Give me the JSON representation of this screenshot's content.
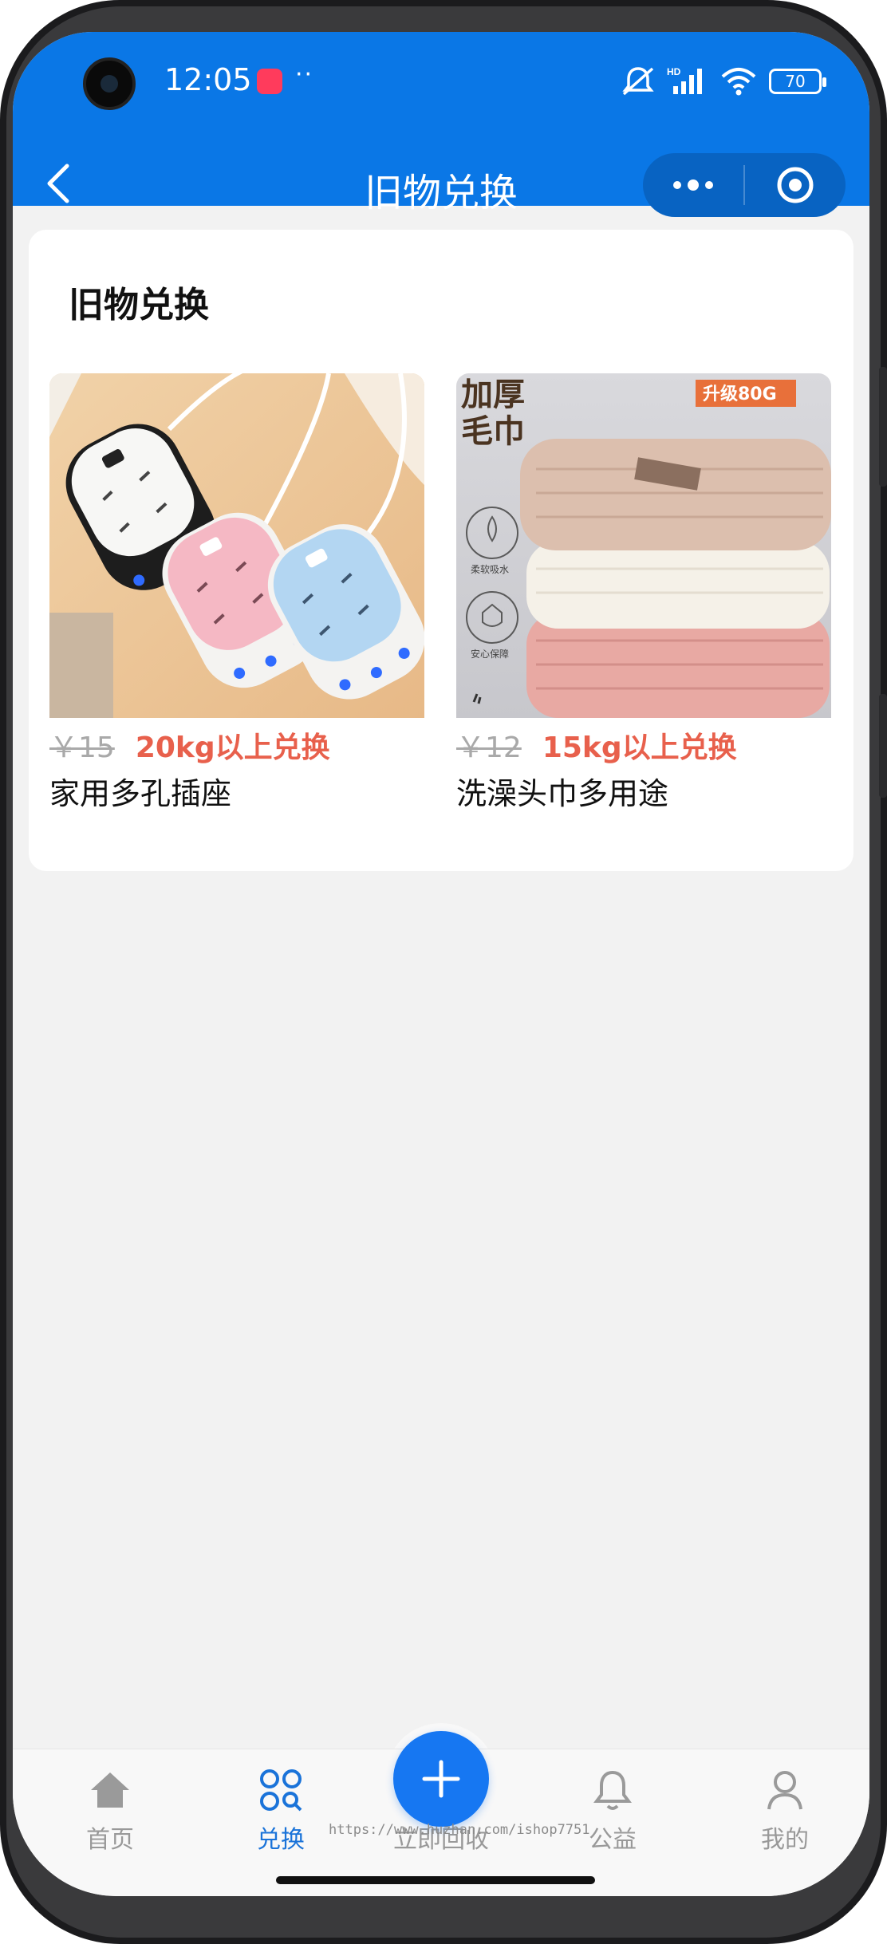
{
  "status_bar": {
    "time": "12:05",
    "dots": "··",
    "battery": "70",
    "icons": [
      "app-notification-icon",
      "mute-icon",
      "hd-signal-icon",
      "wifi-icon",
      "battery-icon"
    ]
  },
  "nav": {
    "title": "旧物兑换",
    "back_icon": "chevron-left-icon",
    "more_icon": "more-dots-icon",
    "close_icon": "target-circle-icon"
  },
  "section": {
    "title": "旧物兑换"
  },
  "products": [
    {
      "old_price": "￥15",
      "exchange": "20kg以上兑换",
      "name": "家用多孔插座",
      "image": "power-strip-photo"
    },
    {
      "old_price": "￥12",
      "exchange": "15kg以上兑换",
      "name": "洗澡头巾多用途",
      "image": "towel-photo",
      "image_text": {
        "headline_1": "加厚",
        "headline_2": "毛巾",
        "tag": "升级80G",
        "feature_1": "柔软吸水",
        "feature_2": "安心保障"
      }
    }
  ],
  "tabbar": {
    "items": [
      {
        "label": "首页",
        "icon": "home-icon",
        "active": false
      },
      {
        "label": "兑换",
        "icon": "exchange-grid-icon",
        "active": true
      },
      {
        "label": "立即回收",
        "icon": "plus-icon",
        "active": false
      },
      {
        "label": "公益",
        "icon": "bell-icon",
        "active": false
      },
      {
        "label": "我的",
        "icon": "user-icon",
        "active": false
      }
    ]
  },
  "watermark": "https://www.huzhan.com/ishop7751",
  "colors": {
    "brand_blue": "#0a77e6",
    "accent_red": "#e8604c",
    "active_tab": "#1a73d9",
    "fab_blue": "#1677f2"
  }
}
